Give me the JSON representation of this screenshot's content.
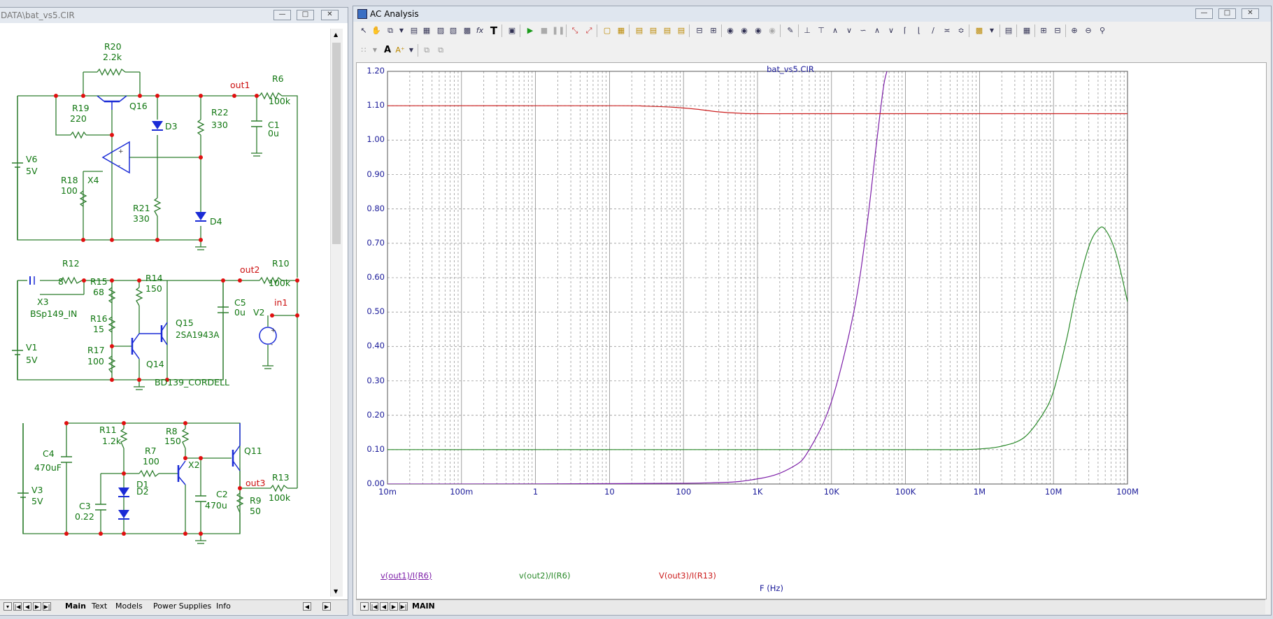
{
  "left_window": {
    "title": "DATA\\bat_vs5.CIR",
    "tabs": [
      "Main",
      "Text",
      "Models",
      "Power Supplies",
      "Info"
    ],
    "active_tab": "Main"
  },
  "schematic": {
    "labels": {
      "R20": "R20",
      "R20v": "2.2k",
      "R19": "R19",
      "R19v": "220",
      "Q16": "Q16",
      "D3": "D3",
      "R22": "R22",
      "R22v": "330",
      "out1": "out1",
      "R6": "R6",
      "R6v": "100k",
      "C1": "C1",
      "C1v": "0u",
      "V6": "V6",
      "V6v": "5V",
      "R18": "R18",
      "R18v": "100",
      "X4": "X4",
      "R21": "R21",
      "R21v": "330",
      "D4": "D4",
      "R12": "R12",
      "R12v": "8",
      "out2": "out2",
      "R10": "R10",
      "R10v": "100k",
      "R15": "R15",
      "R15v": "68",
      "R14": "R14",
      "R14v": "150",
      "X3": "X3",
      "X3v": "BSp149_IN",
      "C5": "C5",
      "C5v": "0u",
      "V2": "V2",
      "in1": "in1",
      "R16": "R16",
      "R16v": "15",
      "Q15": "Q15",
      "Q15v": "2SA1943A",
      "V1": "V1",
      "V1v": "5V",
      "R17": "R17",
      "R17v": "100",
      "Q14": "Q14",
      "Q14v": "BD139_CORDELL",
      "R11": "R11",
      "R11v": "1.2k",
      "R8": "R8",
      "R8v": "150",
      "Q11": "Q11",
      "C4": "C4",
      "C4v": "470uF",
      "R7": "R7",
      "R7v": "100",
      "X2": "X2",
      "D1": "D1",
      "D2": "D2",
      "out3": "out3",
      "R13": "R13",
      "R13v": "100k",
      "V3": "V3",
      "V3v": "5V",
      "C3": "C3",
      "C3v": "0.22",
      "C2": "C2",
      "C2v": "470u",
      "R9": "R9",
      "R9v": "50"
    }
  },
  "right_window": {
    "title": "AC Analysis",
    "tabs": [
      "MAIN"
    ],
    "active_tab": "MAIN"
  },
  "chart_data": {
    "type": "line",
    "title": "bat_vs5.CIR",
    "xlabel": "F (Hz)",
    "ylabel": "",
    "xscale": "log",
    "xlim": [
      0.01,
      100000000
    ],
    "ylim": [
      0,
      1.2
    ],
    "x_tick_labels": [
      "10m",
      "100m",
      "1",
      "10",
      "100",
      "1K",
      "10K",
      "100K",
      "1M",
      "10M",
      "100M"
    ],
    "y_tick_labels": [
      "0.00",
      "0.10",
      "0.20",
      "0.30",
      "0.40",
      "0.50",
      "0.60",
      "0.70",
      "0.80",
      "0.90",
      "1.00",
      "1.10",
      "1.20"
    ],
    "grid": true,
    "series": [
      {
        "name": "v(out1)/I(R6)",
        "color": "#7d1fa8",
        "x": [
          0.01,
          100,
          1000,
          3000,
          5000,
          10000,
          20000,
          30000,
          40000,
          50000,
          56000
        ],
        "y": [
          0.0,
          0.002,
          0.015,
          0.05,
          0.1,
          0.24,
          0.5,
          0.75,
          0.98,
          1.15,
          1.2
        ]
      },
      {
        "name": "v(out2)/I(R6)",
        "color": "#2a8a2a",
        "x": [
          0.01,
          100000,
          500000,
          1000000,
          2000000,
          4000000,
          7000000,
          10000000,
          15000000,
          20000000,
          30000000,
          40000000,
          50000000,
          70000000,
          100000000
        ],
        "y": [
          0.1,
          0.1,
          0.1,
          0.102,
          0.11,
          0.135,
          0.2,
          0.27,
          0.42,
          0.55,
          0.69,
          0.74,
          0.74,
          0.67,
          0.53
        ]
      },
      {
        "name": "V(out3)/I(R13)",
        "color": "#cc2020",
        "x": [
          0.01,
          10,
          30,
          80,
          150,
          300,
          600,
          1000,
          10000,
          100000000
        ],
        "y": [
          1.1,
          1.1,
          1.099,
          1.095,
          1.09,
          1.082,
          1.078,
          1.077,
          1.077,
          1.077
        ]
      }
    ]
  }
}
